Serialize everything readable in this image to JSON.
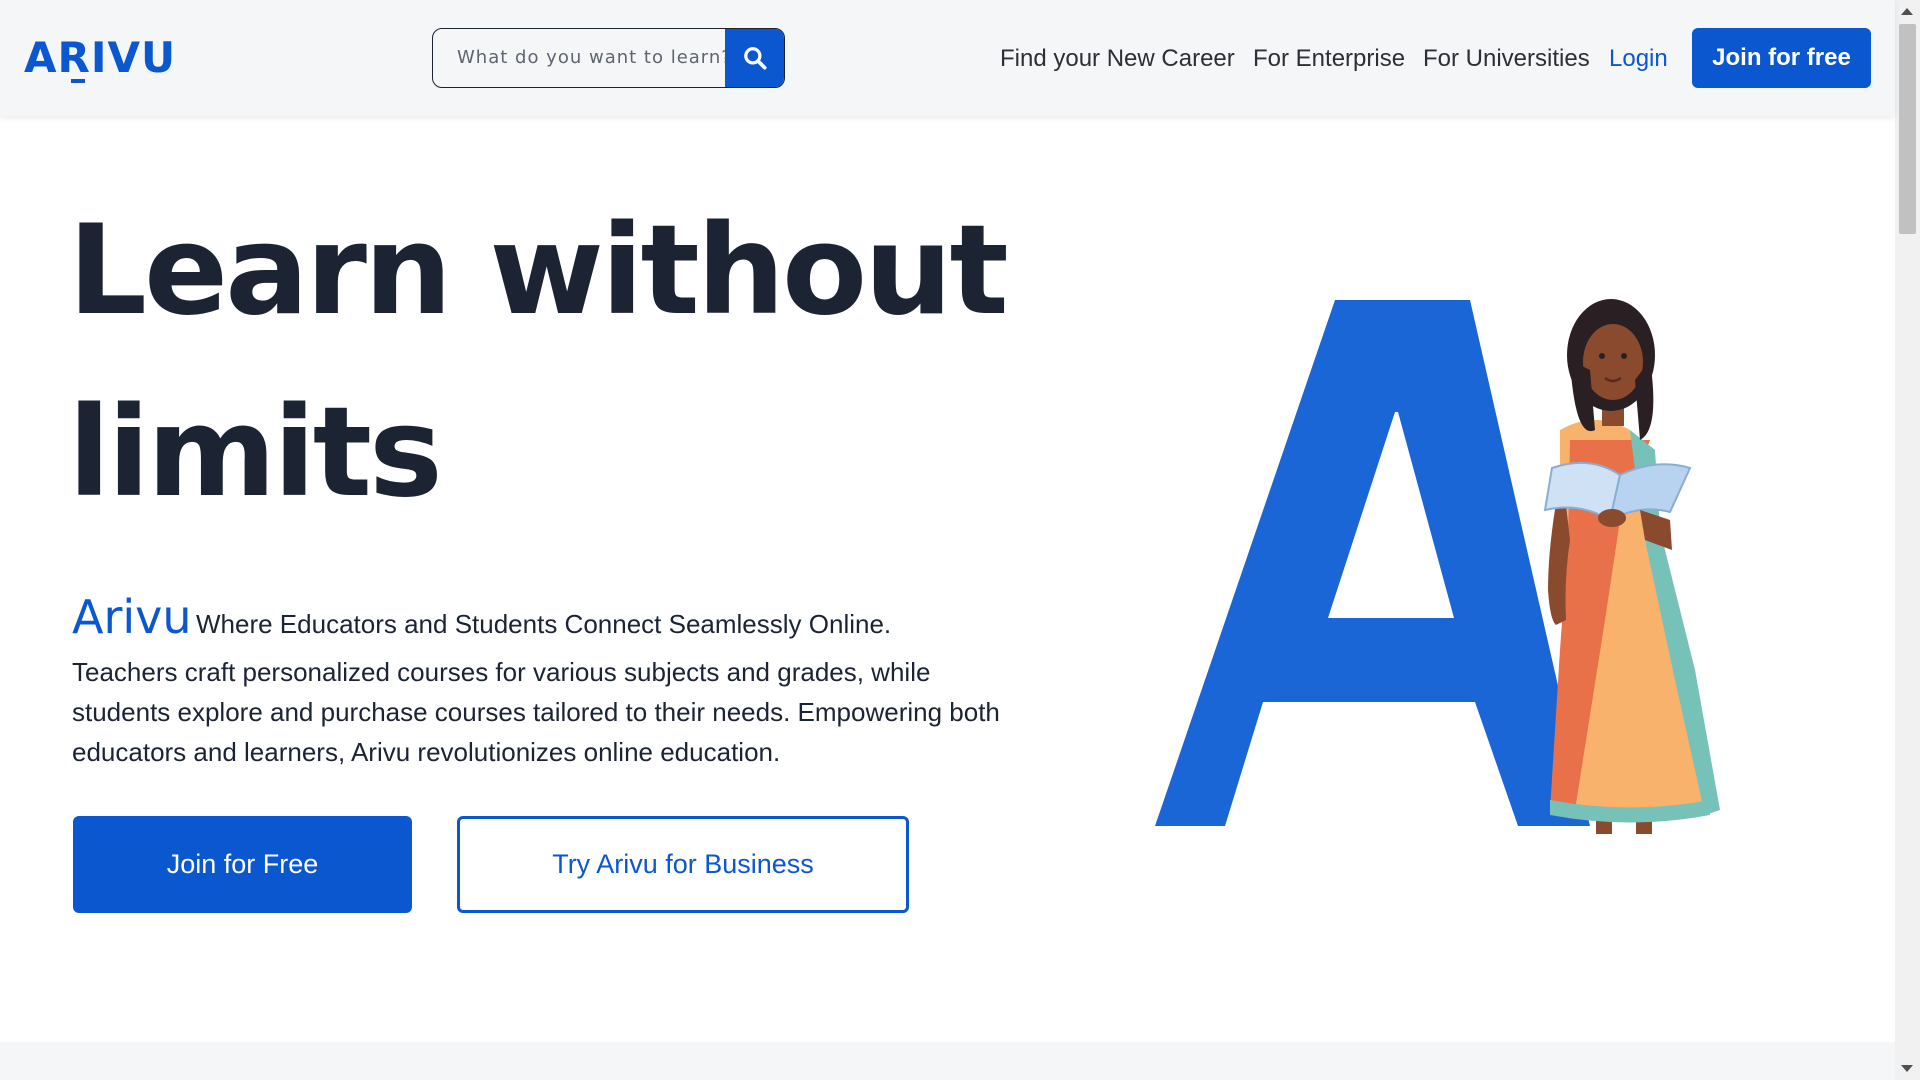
{
  "header": {
    "logo_text": "ARIVU",
    "search": {
      "placeholder": "What do you want to learn?",
      "button_icon": "search-icon"
    },
    "nav": [
      {
        "label": "Find your New Career"
      },
      {
        "label": "For Enterprise"
      },
      {
        "label": "For Universities"
      },
      {
        "label": "Login"
      }
    ],
    "join_label": "Join for free"
  },
  "hero": {
    "title_line1": "Learn without",
    "title_line2": "limits",
    "brand_word": "Arivu",
    "tagline": "Where Educators and Students Connect Seamlessly Online.",
    "description": "Teachers craft personalized courses for various subjects and grades, while students explore and purchase courses tailored to their needs. Empowering both educators and learners, Arivu revolutionizes online education.",
    "primary_button": "Join for Free",
    "secondary_button": "Try Arivu for Business",
    "illustration_icon": "letter-a-woman-reading-illustration"
  },
  "colors": {
    "brand": "#0b57d0",
    "text": "#1c2433",
    "header_bg": "#f5f6f7"
  }
}
